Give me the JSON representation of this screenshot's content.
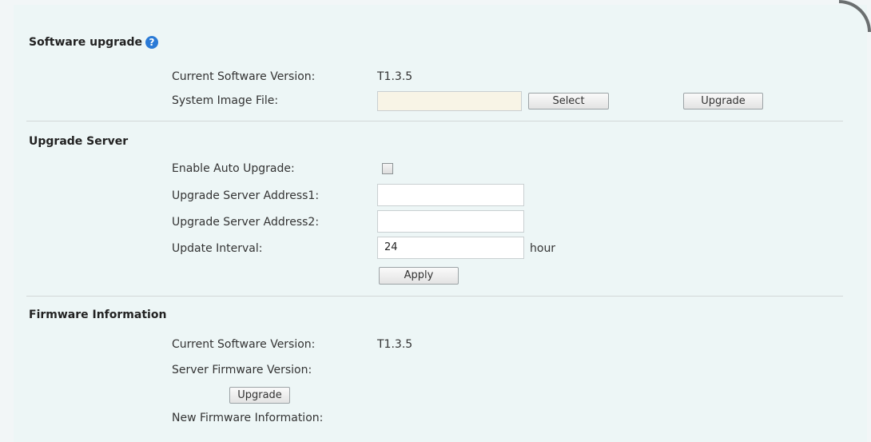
{
  "software_upgrade": {
    "title": "Software upgrade",
    "help_icon": "question-circle-icon",
    "current_version_label": "Current Software Version:",
    "current_version_value": "T1.3.5",
    "system_image_label": "System Image File:",
    "system_image_value": "",
    "select_button": "Select",
    "upgrade_button": "Upgrade"
  },
  "upgrade_server": {
    "title": "Upgrade Server",
    "enable_auto_label": "Enable Auto Upgrade:",
    "enable_auto_checked": false,
    "address1_label": "Upgrade Server Address1:",
    "address1_value": "",
    "address2_label": "Upgrade Server Address2:",
    "address2_value": "",
    "interval_label": "Update Interval:",
    "interval_value": "24",
    "interval_unit": "hour",
    "apply_button": "Apply"
  },
  "firmware_information": {
    "title": "Firmware Information",
    "current_version_label": "Current Software Version:",
    "current_version_value": "T1.3.5",
    "server_version_label": "Server Firmware Version:",
    "upgrade_button": "Upgrade",
    "new_info_label": "New Firmware Information:"
  },
  "colors": {
    "background": "#edf6f6",
    "help_icon": "#2a7ad6",
    "file_input": "#f8f4e6"
  }
}
